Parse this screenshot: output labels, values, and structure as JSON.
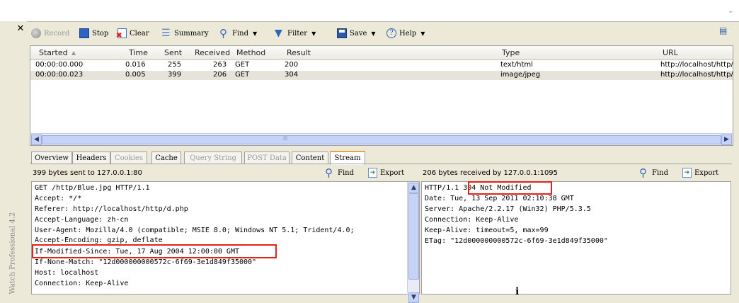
{
  "colors": {
    "highlight": "#e2231a",
    "accent_tab": "#e8a43a",
    "scroll": "#c6d3f7"
  },
  "sidebar": {
    "vertical_label": "Watch Professional 4.2"
  },
  "toolbar": {
    "record": "Record",
    "stop": "Stop",
    "clear": "Clear",
    "summary": "Summary",
    "find": "Find",
    "filter": "Filter",
    "save": "Save",
    "help": "Help"
  },
  "list": {
    "columns": [
      "Started",
      "Time",
      "Sent",
      "Received",
      "Method",
      "Result",
      "Type",
      "URL"
    ],
    "rows": [
      {
        "started": "00:00:00.000",
        "time": "0.016",
        "sent": "255",
        "received": "263",
        "method": "GET",
        "result": "200",
        "type": "text/html",
        "url": "http://localhost/http/"
      },
      {
        "started": "00:00:00.023",
        "time": "0.005",
        "sent": "399",
        "received": "206",
        "method": "GET",
        "result": "304",
        "type": "image/jpeg",
        "url": "http://localhost/http/"
      }
    ]
  },
  "tabs": [
    "Overview",
    "Headers",
    "Cookies",
    "Cache",
    "Query String",
    "POST Data",
    "Content",
    "Stream"
  ],
  "request": {
    "summary": "399 bytes sent to 127.0.0.1:80",
    "find": "Find",
    "export": "Export",
    "lines": [
      "GET /http/Blue.jpg HTTP/1.1",
      "Accept: */*",
      "Referer: http://localhost/http/d.php",
      "Accept-Language: zh-cn",
      "User-Agent: Mozilla/4.0 (compatible; MSIE 8.0; Windows NT 5.1; Trident/4.0;",
      "Accept-Encoding: gzip, deflate",
      "If-Modified-Since: Tue, 17 Aug 2004 12:00:00 GMT",
      "If-None-Match: \"12d000000000572c-6f69-3e1d849f35000\"",
      "Host: localhost",
      "Connection: Keep-Alive"
    ]
  },
  "response": {
    "summary": "206 bytes received by 127.0.0.1:1095",
    "find": "Find",
    "export": "Export",
    "status_prefix": "HTTP/1.1 ",
    "status_text": "304 Not Modified",
    "lines": [
      "Date: Tue, 13 Sep 2011 02:10:38 GMT",
      "Server: Apache/2.2.17 (Win32) PHP/5.3.5",
      "Connection: Keep-Alive",
      "Keep-Alive: timeout=5, max=99",
      "ETag: \"12d000000000572c-6f69-3e1d849f35000\""
    ]
  }
}
